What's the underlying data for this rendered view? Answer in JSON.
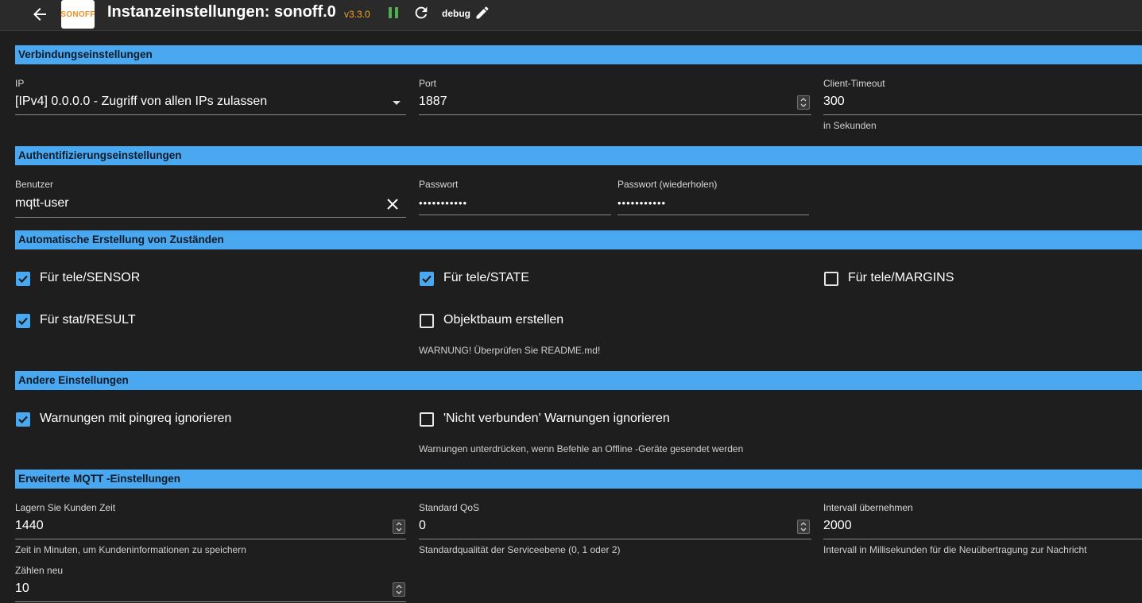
{
  "header": {
    "title": "Instanzeinstellungen: sonoff.0",
    "version": "v3.3.0",
    "loglevel": "debug",
    "logo_text": "SONOFF",
    "accent_version": "#f5a623",
    "accent_running": "#4caf50"
  },
  "sections": {
    "connection": "Verbindungseinstellungen",
    "auth": "Authentifizierungseinstellungen",
    "auto": "Automatische Erstellung von Zuständen",
    "other": "Andere Einstellungen",
    "mqtt": "Erweiterte MQTT -Einstellungen"
  },
  "connection": {
    "ip_label": "IP",
    "ip_value": "[IPv4] 0.0.0.0 - Zugriff von allen IPs zulassen",
    "port_label": "Port",
    "port_value": "1887",
    "timeout_label": "Client-Timeout",
    "timeout_value": "300",
    "timeout_helper": "in Sekunden"
  },
  "auth": {
    "user_label": "Benutzer",
    "user_value": "mqtt-user",
    "password_label": "Passwort",
    "password_value": "•••••••••••",
    "password_repeat_label": "Passwort (wiederholen)",
    "password_repeat_value": "•••••••••••"
  },
  "auto": {
    "tele_sensor": "Für tele/SENSOR",
    "tele_state": "Für tele/STATE",
    "tele_margins": "Für tele/MARGINS",
    "stat_result": "Für stat/RESULT",
    "object_tree": "Objektbaum erstellen",
    "object_tree_helper": "WARNUNG! Überprüfen Sie README.md!"
  },
  "other": {
    "ignore_pingreq": "Warnungen mit pingreq ignorieren",
    "ignore_not_connected": "'Nicht verbunden' Warnungen ignorieren",
    "ignore_not_connected_helper": "Warnungen unterdrücken, wenn Befehle an Offline -Geräte gesendet werden"
  },
  "mqtt": {
    "store_label": "Lagern Sie Kunden Zeit",
    "store_value": "1440",
    "store_helper": "Zeit in Minuten, um Kundeninformationen zu speichern",
    "qos_label": "Standard QoS",
    "qos_value": "0",
    "qos_helper": "Standardqualität der Serviceebene (0, 1 oder 2)",
    "retransmit_label": "Intervall übernehmen",
    "retransmit_value": "2000",
    "retransmit_helper": "Intervall in Millisekunden für die Neuübertragung zur Nachricht",
    "recount_label": "Zählen neu",
    "recount_value": "10"
  }
}
